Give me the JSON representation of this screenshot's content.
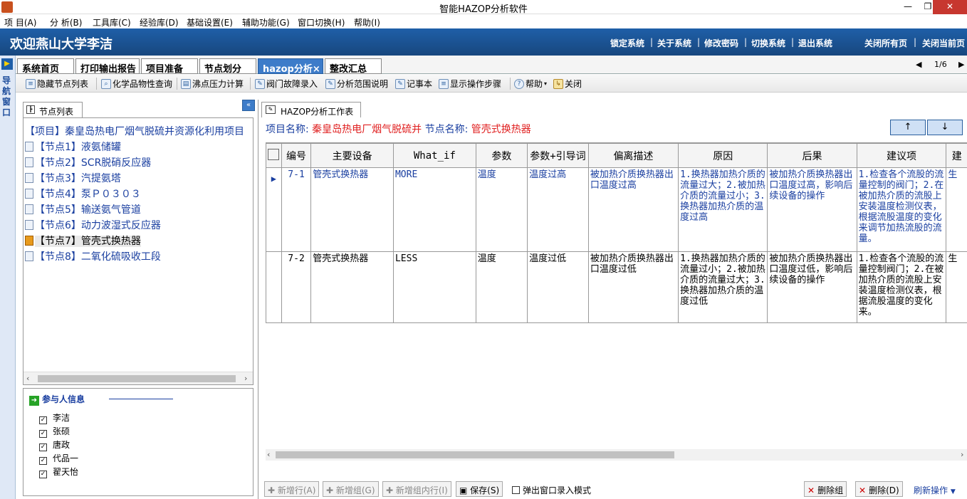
{
  "window": {
    "title": "智能HAZOP分析软件",
    "min": "—",
    "max": "❐",
    "close": "✕"
  },
  "menu": [
    "项 目(A)",
    "分 析(B)",
    "工具库(C)",
    "经验库(D)",
    "基础设置(E)",
    "辅助功能(G)",
    "窗口切换(H)",
    "帮助(I)"
  ],
  "banner": {
    "welcome": "欢迎燕山大学李洁",
    "links": [
      "锁定系统",
      "关于系统",
      "修改密码",
      "切换系统",
      "退出系统",
      "关闭所有页",
      "关闭当前页"
    ]
  },
  "nav_strip": {
    "label": "导航窗口"
  },
  "tabs": [
    {
      "label": "系统首页"
    },
    {
      "label": "打印输出报告"
    },
    {
      "label": "项目准备"
    },
    {
      "label": "节点划分"
    },
    {
      "label": "hazop分析×",
      "active": true
    },
    {
      "label": "整改汇总"
    }
  ],
  "tab_pager": {
    "text": "1/6"
  },
  "toolbar": [
    "隐藏节点列表",
    "化学品物性查询",
    "沸点压力计算",
    "阀门故障录入",
    "分析范围说明",
    "记事本",
    "显示操作步骤",
    "帮助",
    "关闭"
  ],
  "node_panel": {
    "tab_label": "节点列表",
    "project": "【项目】秦皇岛热电厂烟气脱硫并资源化利用项目",
    "nodes": [
      "【节点1】液氨储罐",
      "【节点2】SCR脱硝反应器",
      "【节点3】汽提氨塔",
      "【节点4】泵Ｐ０３０３",
      "【节点5】输送氨气管道",
      "【节点6】动力波湿式反应器",
      "【节点7】管壳式换热器",
      "【节点8】二氧化硫吸收工段"
    ],
    "selected_index": 6
  },
  "participants": {
    "title": "参与人信息",
    "people": [
      "李洁",
      "张硕",
      "唐政",
      "代品一",
      "翟天怡"
    ]
  },
  "worksheet": {
    "tab_label": "HAZOP分析工作表",
    "project_label": "项目名称:",
    "project_value": "秦皇岛热电厂烟气脱硫并",
    "node_label": "节点名称:",
    "node_value": "管壳式换热器",
    "up": "↑",
    "down": "↓",
    "columns": [
      "编号",
      "主要设备",
      "What_if",
      "参数",
      "参数+引导词",
      "偏离描述",
      "原因",
      "后果",
      "建议项",
      "建"
    ],
    "rows": [
      {
        "cells": [
          "7-1",
          "管壳式换热器",
          "MORE",
          "温度",
          "温度过高",
          "被加热介质换热器出口温度过高",
          "1.换热器加热介质的流量过大；2.被加热介质的流量过小；3.换热器加热介质的温度过高",
          "被加热介质换热器出口温度过高，影响后续设备的操作",
          "1.检查各个流股的流量控制的阀门；2.在被加热介质的流股上安装温度检测仪表，根据流股温度的变化来调节加热流股的流量。",
          "生"
        ]
      },
      {
        "cells": [
          "7-2",
          "管壳式换热器",
          "LESS",
          "温度",
          "温度过低",
          "被加热介质换热器出口温度过低",
          "1.换热器加热介质的流量过小；2.被加热介质的流量过大；3.换热器加热介质的温度过低",
          "被加热介质换热器出口温度过低，影响后续设备的操作",
          "1.检查各个流股的流量控制阀门；2.在被加热介质的流股上安装温度检测仪表，根据流股温度的变化来。",
          "生"
        ]
      }
    ]
  },
  "bottom": {
    "add_row": "新增行(A)",
    "add_group": "新增组(G)",
    "add_group_row": "新增组内行(I)",
    "save": "保存(S)",
    "popup_mode": "弹出窗口录入模式",
    "delete_group": "删除组",
    "delete": "删除(D)",
    "refresh": "刷新操作"
  }
}
